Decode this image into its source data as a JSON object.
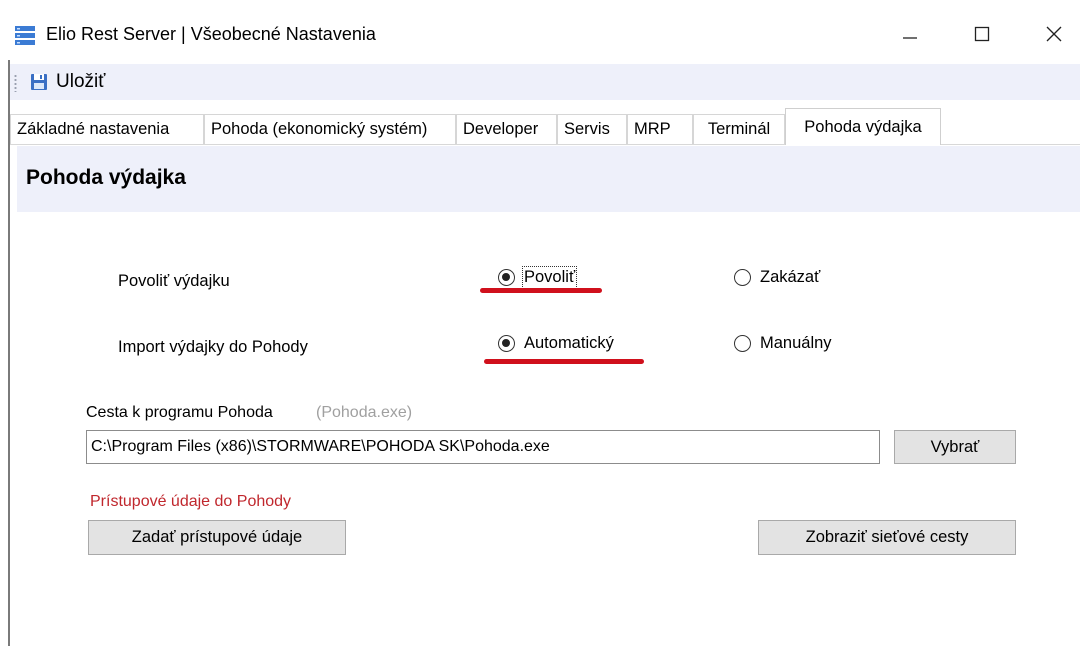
{
  "window": {
    "title": "Elio Rest Server | Všeobecné Nastavenia",
    "app_icon": "server-stack-icon"
  },
  "toolbar": {
    "save_label": "Uložiť",
    "save_icon": "floppy-disk-icon"
  },
  "tabs": [
    {
      "label": "Základné nastavenia",
      "active": false
    },
    {
      "label": "Pohoda (ekonomický systém)",
      "active": false
    },
    {
      "label": "Developer",
      "active": false
    },
    {
      "label": "Servis",
      "active": false
    },
    {
      "label": "MRP",
      "active": false
    },
    {
      "label": "Terminál",
      "active": false
    },
    {
      "label": "Pohoda výdajka",
      "active": true
    }
  ],
  "page": {
    "title": "Pohoda výdajka",
    "enable_issue": {
      "label": "Povoliť výdajku",
      "options": [
        {
          "label": "Povoliť",
          "selected": true
        },
        {
          "label": "Zakázať",
          "selected": false
        }
      ]
    },
    "import_issue": {
      "label": "Import výdajky do Pohody",
      "options": [
        {
          "label": "Automatický",
          "selected": true
        },
        {
          "label": "Manuálny",
          "selected": false
        }
      ]
    },
    "program_path": {
      "label": "Cesta k programu Pohoda",
      "hint": "(Pohoda.exe)",
      "value": "C:\\Program Files (x86)\\STORMWARE\\POHODA SK\\Pohoda.exe",
      "browse_label": "Vybrať"
    },
    "credentials": {
      "label": "Prístupové údaje do Pohody",
      "button_label": "Zadať prístupové údaje"
    },
    "network_paths_button_label": "Zobraziť sieťové cesty"
  },
  "colors": {
    "accent_band": "#eef0fa",
    "warning_text": "#c0272d",
    "annotation_underline": "#d0101c"
  }
}
